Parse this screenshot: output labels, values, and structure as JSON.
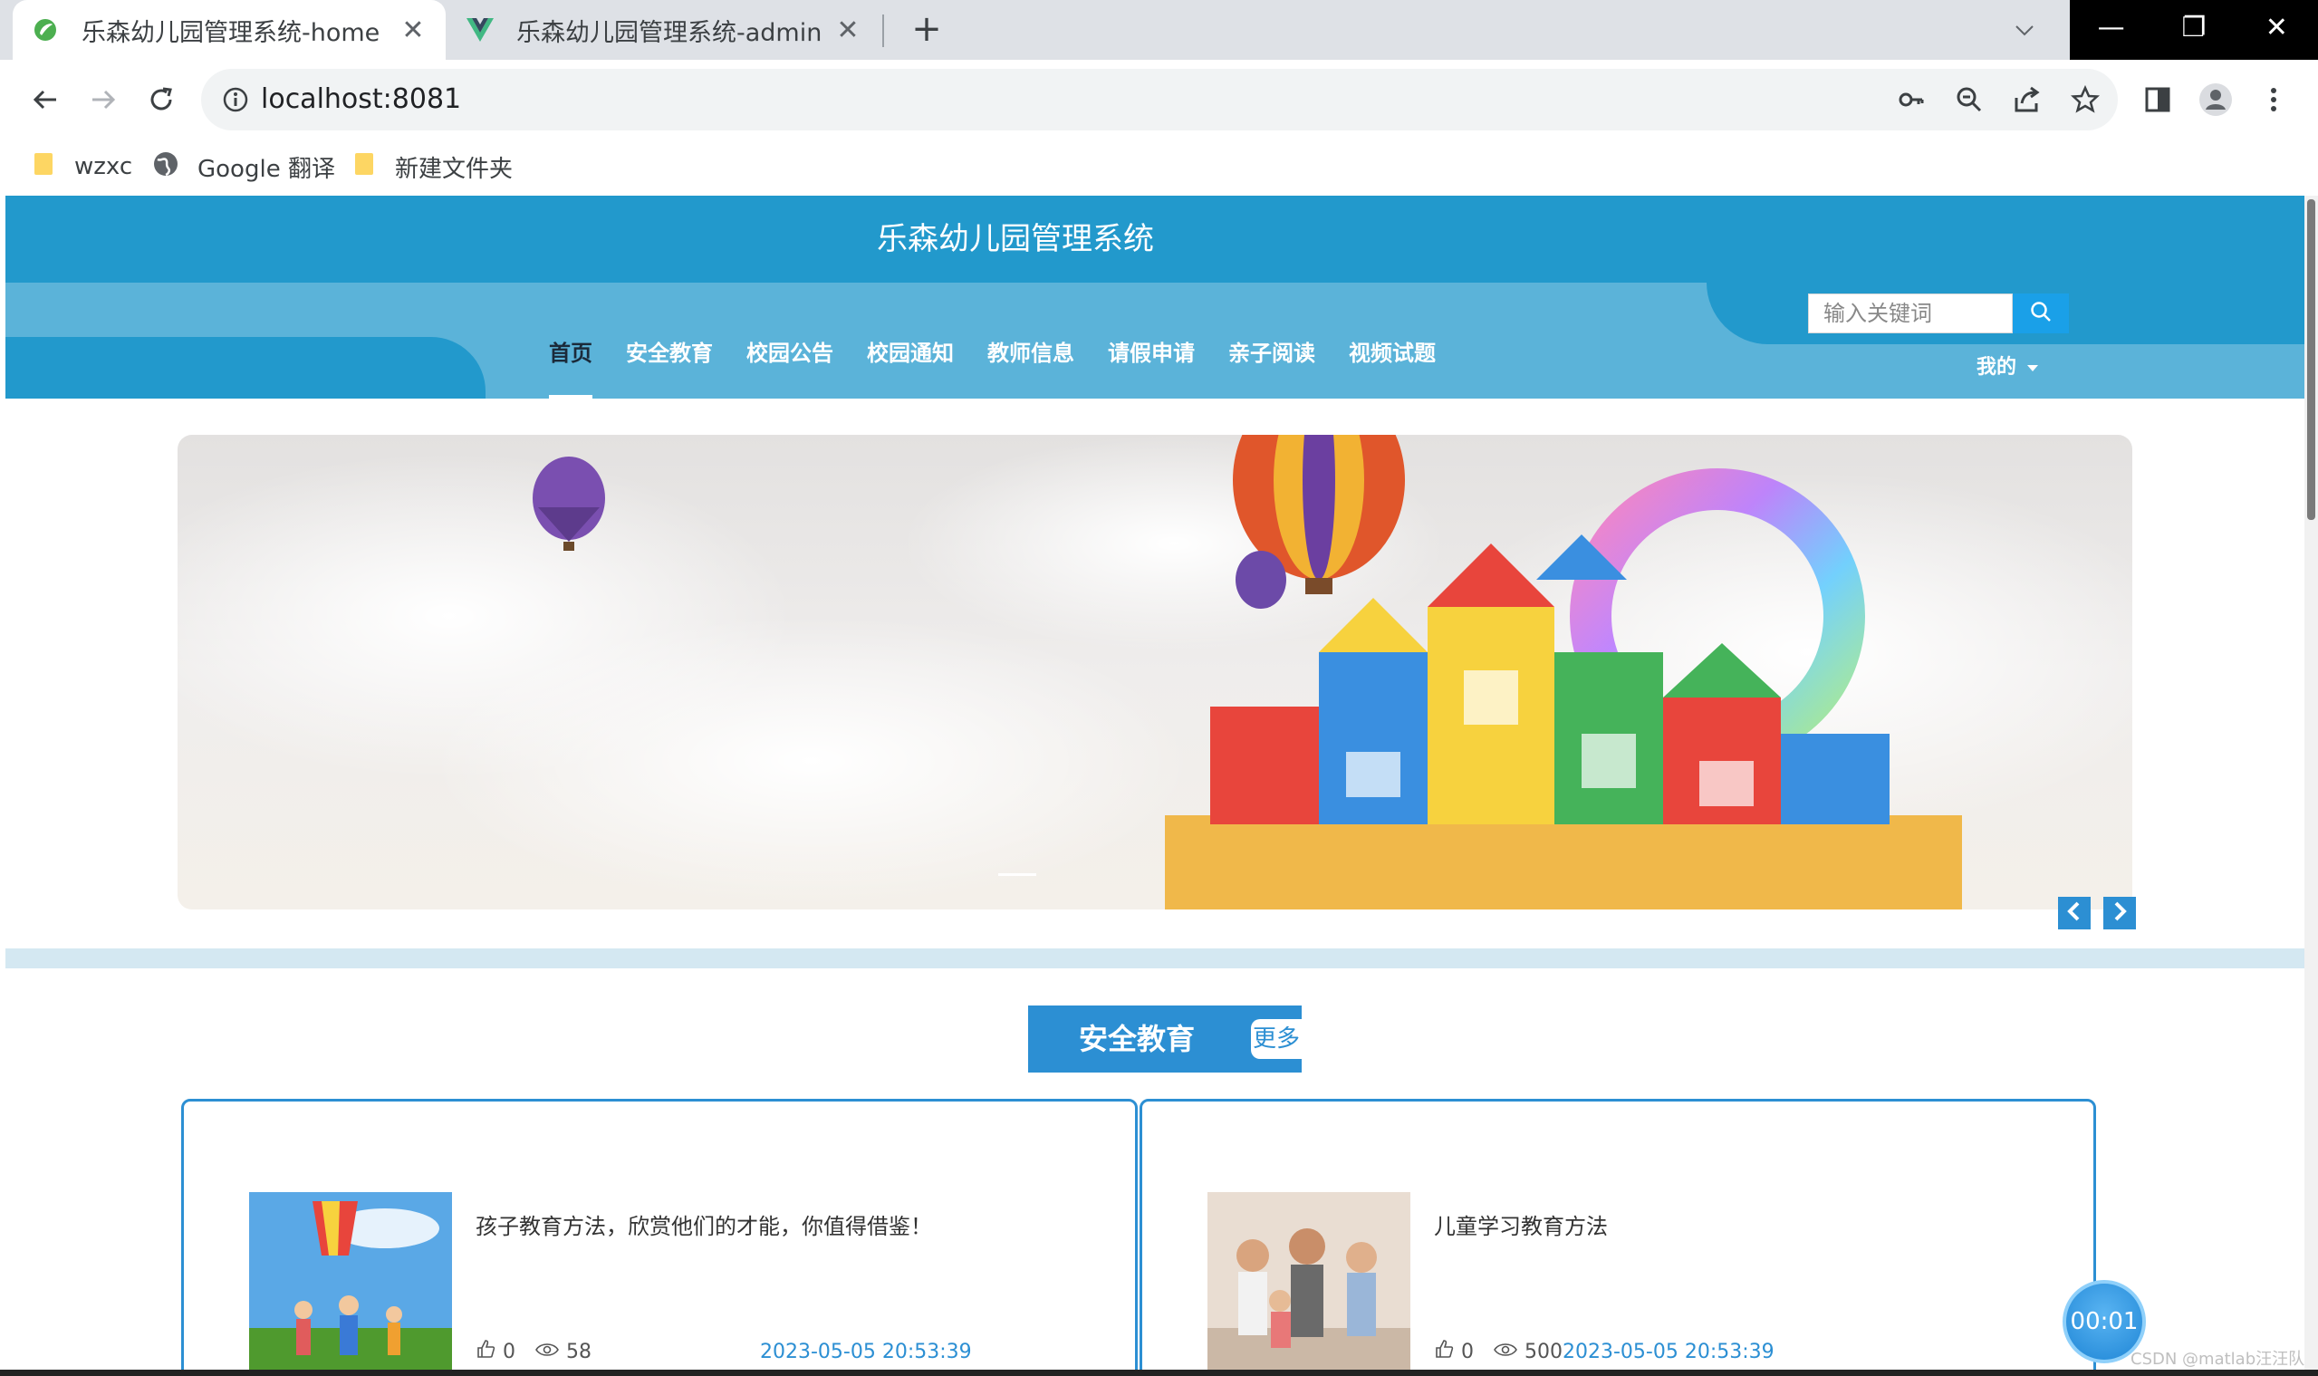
{
  "browser": {
    "tabs": [
      {
        "title": "乐森幼儿园管理系统-home",
        "favicon": "leaf-green-icon"
      },
      {
        "title": "乐森幼儿园管理系统-admin",
        "favicon": "vue-v-icon"
      }
    ],
    "url": "localhost:8081",
    "bookmarks": [
      {
        "label": "wzxc",
        "icon": "folder-icon"
      },
      {
        "label": "Google 翻译",
        "icon": "globe-icon"
      },
      {
        "label": "新建文件夹",
        "icon": "folder-icon"
      }
    ]
  },
  "site": {
    "title": "乐森幼儿园管理系统",
    "nav": [
      "首页",
      "安全教育",
      "校园公告",
      "校园通知",
      "教师信息",
      "请假申请",
      "亲子阅读",
      "视频试题"
    ],
    "active_nav": "首页",
    "search_placeholder": "输入关键词",
    "user_menu": "我的",
    "accent_color": "#2299cc"
  },
  "section": {
    "title": "安全教育",
    "more_label": "更多",
    "cards": [
      {
        "title": "孩子教育方法，欣赏他们的才能，你值得借鉴！",
        "likes": "0",
        "views": "58",
        "date": "2023-05-05 20:53:39"
      },
      {
        "title": "儿童学习教育方法",
        "likes": "0",
        "views": "500",
        "date": "2023-05-05 20:53:39"
      }
    ]
  },
  "overlay": {
    "timer": "00:01",
    "watermark": "CSDN @matlab汪汪队"
  }
}
